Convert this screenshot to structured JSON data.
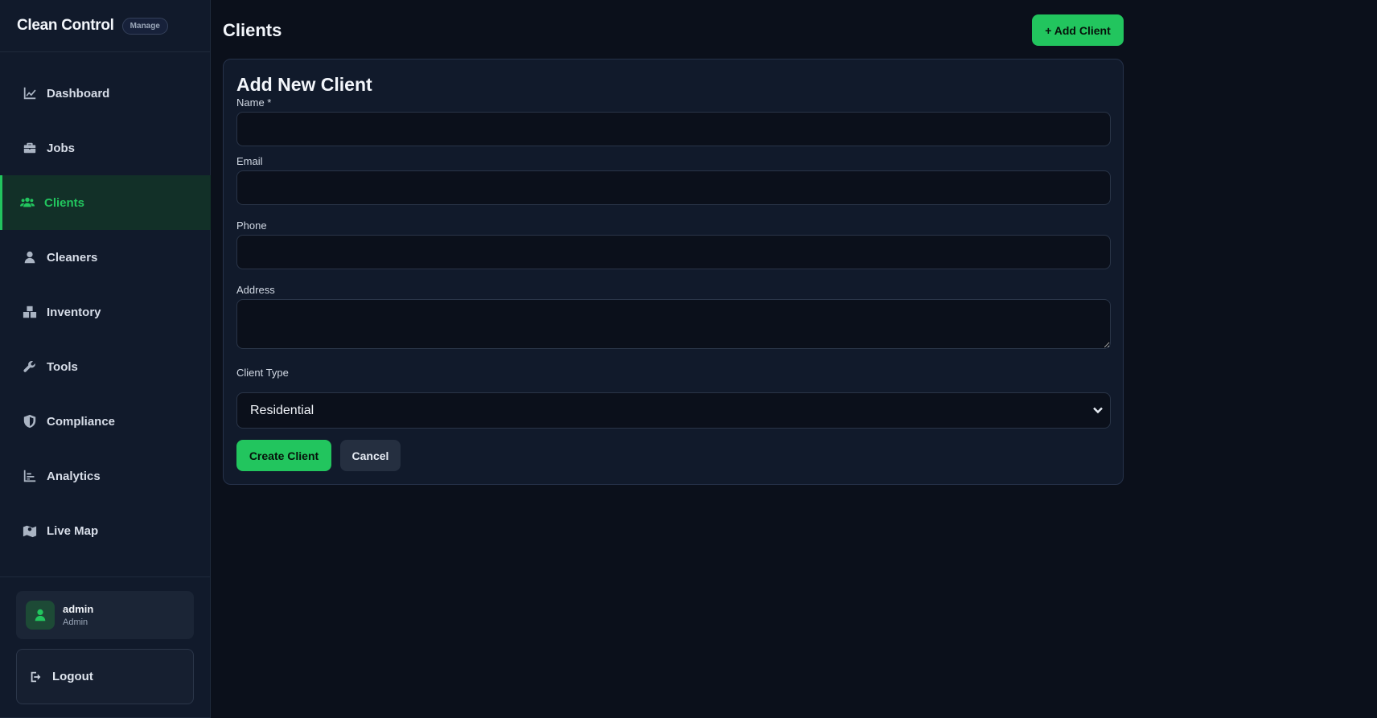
{
  "app": {
    "brand": "Clean Control",
    "badge": "Manage"
  },
  "sidebar": {
    "items": [
      {
        "label": "Dashboard",
        "icon": "chart-line-icon"
      },
      {
        "label": "Jobs",
        "icon": "briefcase-icon"
      },
      {
        "label": "Clients",
        "icon": "users-icon",
        "active": true
      },
      {
        "label": "Cleaners",
        "icon": "user-icon"
      },
      {
        "label": "Inventory",
        "icon": "boxes-icon"
      },
      {
        "label": "Tools",
        "icon": "wrench-icon"
      },
      {
        "label": "Compliance",
        "icon": "shield-icon"
      },
      {
        "label": "Analytics",
        "icon": "bar-chart-icon"
      },
      {
        "label": "Live Map",
        "icon": "map-icon"
      }
    ],
    "user": {
      "name": "admin",
      "role": "Admin",
      "icon": "user-icon"
    },
    "logout": {
      "label": "Logout",
      "icon": "logout-icon"
    }
  },
  "header": {
    "title": "Clients",
    "add_button": "+ Add Client"
  },
  "form": {
    "title": "Add New Client",
    "name_label": "Name *",
    "name_value": "",
    "email_label": "Email",
    "email_value": "",
    "phone_label": "Phone",
    "phone_value": "",
    "address_label": "Address",
    "address_value": "",
    "client_type_label": "Client Type",
    "client_type_value": "Residential",
    "create_button": "Create Client",
    "cancel_button": "Cancel"
  },
  "colors": {
    "accent": "#22c55e",
    "background": "#0b101b",
    "panel": "#111a2b"
  }
}
